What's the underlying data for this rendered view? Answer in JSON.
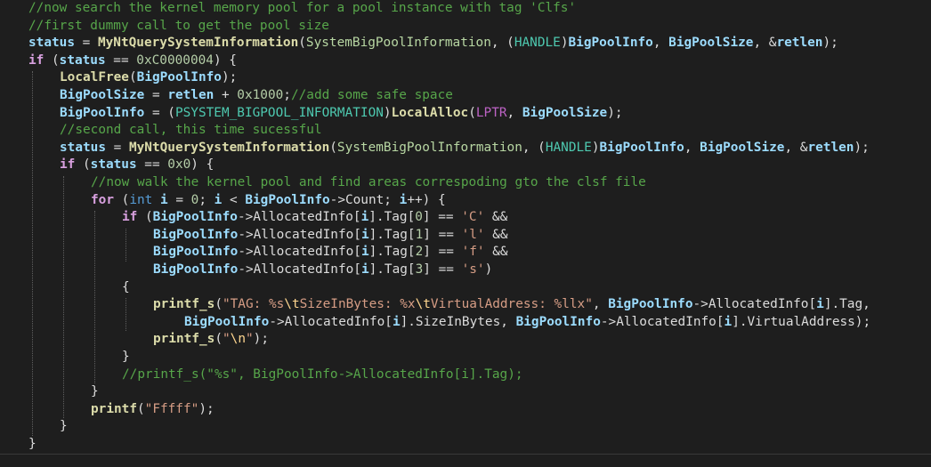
{
  "colors": {
    "background": "#1e1e1e",
    "comment": "#57a64a",
    "variable": "#9cdcfe",
    "function": "#dcdcaa",
    "text": "#dcdcdc",
    "number": "#b5cea8",
    "keyword": "#569cd6",
    "control_keyword": "#d8a0df",
    "type": "#4ec9b0",
    "macro": "#bd63c5",
    "string": "#d69d85",
    "escape": "#ffd68f",
    "enum_constant": "#b8d7a3",
    "indent_guide": "#5f5f5f"
  },
  "code": {
    "lines": [
      {
        "indent": 1,
        "tokens": [
          [
            "cmt",
            "//now search the kernel memory pool for a pool instance with tag 'Clfs'"
          ]
        ]
      },
      {
        "indent": 1,
        "tokens": [
          [
            "cmt",
            "//first dummy call to get the pool size"
          ]
        ]
      },
      {
        "indent": 1,
        "tokens": [
          [
            "var",
            "status"
          ],
          [
            "txt",
            " = "
          ],
          [
            "fn",
            "MyNtQuerySystemInformation"
          ],
          [
            "txt",
            "("
          ],
          [
            "cst",
            "SystemBigPoolInformation"
          ],
          [
            "txt",
            ", ("
          ],
          [
            "typ",
            "HANDLE"
          ],
          [
            "txt",
            ")"
          ],
          [
            "var",
            "BigPoolInfo"
          ],
          [
            "txt",
            ", "
          ],
          [
            "var",
            "BigPoolSize"
          ],
          [
            "txt",
            ", &"
          ],
          [
            "var",
            "retlen"
          ],
          [
            "txt",
            ");"
          ]
        ]
      },
      {
        "indent": 1,
        "tokens": [
          [
            "kwb",
            "if"
          ],
          [
            "txt",
            " ("
          ],
          [
            "var",
            "status"
          ],
          [
            "txt",
            " == "
          ],
          [
            "num",
            "0xC0000004"
          ],
          [
            "txt",
            ") {"
          ]
        ]
      },
      {
        "indent": 2,
        "tokens": [
          [
            "fn",
            "LocalFree"
          ],
          [
            "txt",
            "("
          ],
          [
            "var",
            "BigPoolInfo"
          ],
          [
            "txt",
            ");"
          ]
        ]
      },
      {
        "indent": 2,
        "tokens": [
          [
            "var",
            "BigPoolSize"
          ],
          [
            "txt",
            " = "
          ],
          [
            "var",
            "retlen"
          ],
          [
            "txt",
            " + "
          ],
          [
            "num",
            "0x1000"
          ],
          [
            "txt",
            ";"
          ],
          [
            "cmt",
            "//add some safe space"
          ]
        ]
      },
      {
        "indent": 2,
        "tokens": [
          [
            "var",
            "BigPoolInfo"
          ],
          [
            "txt",
            " = ("
          ],
          [
            "typ",
            "PSYSTEM_BIGPOOL_INFORMATION"
          ],
          [
            "txt",
            ")"
          ],
          [
            "fn",
            "LocalAlloc"
          ],
          [
            "txt",
            "("
          ],
          [
            "mac",
            "LPTR"
          ],
          [
            "txt",
            ", "
          ],
          [
            "var",
            "BigPoolSize"
          ],
          [
            "txt",
            ");"
          ]
        ]
      },
      {
        "indent": 2,
        "tokens": [
          [
            "cmt",
            "//second call, this time sucessful"
          ]
        ]
      },
      {
        "indent": 2,
        "tokens": [
          [
            "var",
            "status"
          ],
          [
            "txt",
            " = "
          ],
          [
            "fn",
            "MyNtQuerySystemInformation"
          ],
          [
            "txt",
            "("
          ],
          [
            "cst",
            "SystemBigPoolInformation"
          ],
          [
            "txt",
            ", ("
          ],
          [
            "typ",
            "HANDLE"
          ],
          [
            "txt",
            ")"
          ],
          [
            "var",
            "BigPoolInfo"
          ],
          [
            "txt",
            ", "
          ],
          [
            "var",
            "BigPoolSize"
          ],
          [
            "txt",
            ", &"
          ],
          [
            "var",
            "retlen"
          ],
          [
            "txt",
            ");"
          ]
        ]
      },
      {
        "indent": 2,
        "tokens": [
          [
            "kwb",
            "if"
          ],
          [
            "txt",
            " ("
          ],
          [
            "var",
            "status"
          ],
          [
            "txt",
            " == "
          ],
          [
            "num",
            "0x0"
          ],
          [
            "txt",
            ") {"
          ]
        ]
      },
      {
        "indent": 3,
        "tokens": [
          [
            "cmt",
            "//now walk the kernel pool and find areas correspoding gto the clsf file"
          ]
        ]
      },
      {
        "indent": 3,
        "tokens": [
          [
            "kwb",
            "for"
          ],
          [
            "txt",
            " ("
          ],
          [
            "kw",
            "int"
          ],
          [
            "txt",
            " "
          ],
          [
            "var",
            "i"
          ],
          [
            "txt",
            " = "
          ],
          [
            "num",
            "0"
          ],
          [
            "txt",
            "; "
          ],
          [
            "var",
            "i"
          ],
          [
            "txt",
            " < "
          ],
          [
            "var",
            "BigPoolInfo"
          ],
          [
            "txt",
            "->Count; "
          ],
          [
            "var",
            "i"
          ],
          [
            "txt",
            "++) {"
          ]
        ]
      },
      {
        "indent": 4,
        "tokens": [
          [
            "kwb",
            "if"
          ],
          [
            "txt",
            " ("
          ],
          [
            "var",
            "BigPoolInfo"
          ],
          [
            "txt",
            "->AllocatedInfo["
          ],
          [
            "var",
            "i"
          ],
          [
            "txt",
            "].Tag["
          ],
          [
            "num",
            "0"
          ],
          [
            "txt",
            "] == "
          ],
          [
            "str",
            "'C'"
          ],
          [
            "txt",
            " &&"
          ]
        ]
      },
      {
        "indent": 5,
        "tokens": [
          [
            "var",
            "BigPoolInfo"
          ],
          [
            "txt",
            "->AllocatedInfo["
          ],
          [
            "var",
            "i"
          ],
          [
            "txt",
            "].Tag["
          ],
          [
            "num",
            "1"
          ],
          [
            "txt",
            "] == "
          ],
          [
            "str",
            "'l'"
          ],
          [
            "txt",
            " &&"
          ]
        ]
      },
      {
        "indent": 5,
        "tokens": [
          [
            "var",
            "BigPoolInfo"
          ],
          [
            "txt",
            "->AllocatedInfo["
          ],
          [
            "var",
            "i"
          ],
          [
            "txt",
            "].Tag["
          ],
          [
            "num",
            "2"
          ],
          [
            "txt",
            "] == "
          ],
          [
            "str",
            "'f'"
          ],
          [
            "txt",
            " &&"
          ]
        ]
      },
      {
        "indent": 5,
        "tokens": [
          [
            "var",
            "BigPoolInfo"
          ],
          [
            "txt",
            "->AllocatedInfo["
          ],
          [
            "var",
            "i"
          ],
          [
            "txt",
            "].Tag["
          ],
          [
            "num",
            "3"
          ],
          [
            "txt",
            "] == "
          ],
          [
            "str",
            "'s'"
          ],
          [
            "txt",
            ")"
          ]
        ]
      },
      {
        "indent": 4,
        "tokens": [
          [
            "txt",
            "{"
          ]
        ]
      },
      {
        "indent": 5,
        "tokens": [
          [
            "fn",
            "printf_s"
          ],
          [
            "txt",
            "("
          ],
          [
            "str",
            "\"TAG: %s"
          ],
          [
            "esc",
            "\\t"
          ],
          [
            "str",
            "SizeInBytes: %x"
          ],
          [
            "esc",
            "\\t"
          ],
          [
            "str",
            "VirtualAddress: %llx\""
          ],
          [
            "txt",
            ", "
          ],
          [
            "var",
            "BigPoolInfo"
          ],
          [
            "txt",
            "->AllocatedInfo["
          ],
          [
            "var",
            "i"
          ],
          [
            "txt",
            "].Tag,"
          ]
        ]
      },
      {
        "indent": 6,
        "tokens": [
          [
            "var",
            "BigPoolInfo"
          ],
          [
            "txt",
            "->AllocatedInfo["
          ],
          [
            "var",
            "i"
          ],
          [
            "txt",
            "].SizeInBytes, "
          ],
          [
            "var",
            "BigPoolInfo"
          ],
          [
            "txt",
            "->AllocatedInfo["
          ],
          [
            "var",
            "i"
          ],
          [
            "txt",
            "].VirtualAddress);"
          ]
        ]
      },
      {
        "indent": 5,
        "tokens": [
          [
            "fn",
            "printf_s"
          ],
          [
            "txt",
            "("
          ],
          [
            "str",
            "\""
          ],
          [
            "esc",
            "\\n"
          ],
          [
            "str",
            "\""
          ],
          [
            "txt",
            ");"
          ]
        ]
      },
      {
        "indent": 4,
        "tokens": [
          [
            "txt",
            "}"
          ]
        ]
      },
      {
        "indent": 4,
        "tokens": [
          [
            "cmt",
            "//printf_s(\"%s\", BigPoolInfo->AllocatedInfo[i].Tag);"
          ]
        ]
      },
      {
        "indent": 3,
        "tokens": [
          [
            "txt",
            "}"
          ]
        ]
      },
      {
        "indent": 3,
        "tokens": [
          [
            "fn",
            "printf"
          ],
          [
            "txt",
            "("
          ],
          [
            "str",
            "\"Fffff\""
          ],
          [
            "txt",
            ");"
          ]
        ]
      },
      {
        "indent": 2,
        "tokens": [
          [
            "txt",
            "}"
          ]
        ]
      },
      {
        "indent": 1,
        "tokens": [
          [
            "txt",
            "}"
          ]
        ]
      }
    ],
    "guides": [
      {
        "level": 1,
        "from": 4,
        "to": 25
      },
      {
        "level": 2,
        "from": 10,
        "to": 24
      },
      {
        "level": 3,
        "from": 12,
        "to": 22
      },
      {
        "level": 4,
        "from": 13,
        "to": 15
      },
      {
        "level": 4,
        "from": 17,
        "to": 19
      }
    ]
  }
}
